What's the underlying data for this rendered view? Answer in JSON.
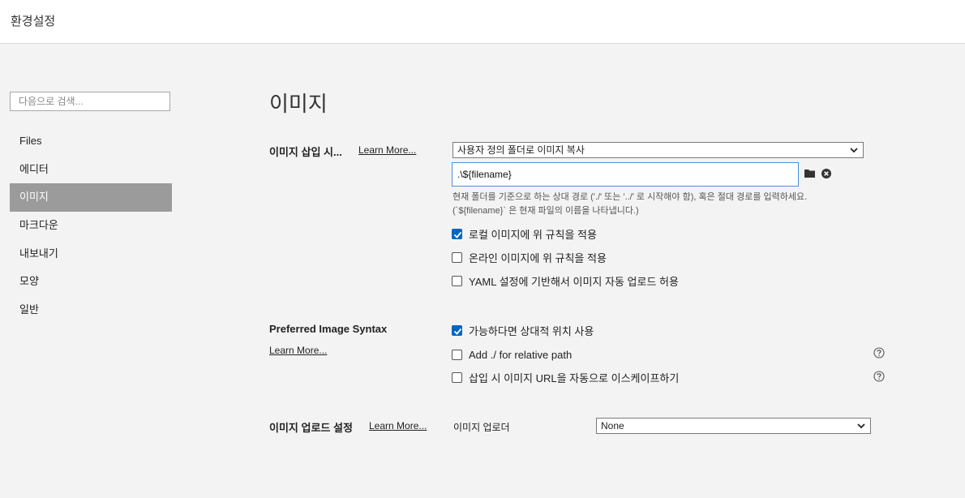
{
  "window": {
    "title": "환경설정"
  },
  "search": {
    "placeholder": "다음으로 검색..."
  },
  "sidebar": {
    "items": [
      {
        "label": "Files"
      },
      {
        "label": "에디터"
      },
      {
        "label": "이미지",
        "active": true
      },
      {
        "label": "마크다운"
      },
      {
        "label": "내보내기"
      },
      {
        "label": "모양"
      },
      {
        "label": "일반"
      }
    ]
  },
  "page": {
    "title": "이미지"
  },
  "insert_image": {
    "label": "이미지 삽입 시...",
    "learn_more": "Learn More...",
    "select_value": "사용자 정의 폴더로 이미지 복사",
    "path_value": ".\\${filename}",
    "folder_icon": "folder-icon",
    "clear_icon": "clear-icon",
    "hint_line1": "현재 폴더를 기준으로 하는 상대 경로 ('./' 또는 '../' 로 시작해야 함), 혹은 절대 경로를 입력하세요.",
    "hint_line2": "(`${filename}` 은 현재 파일의 이름을 나타냅니다.)",
    "options": [
      {
        "label": "로컬 이미지에 위 규칙을 적용",
        "checked": true
      },
      {
        "label": "온라인 이미지에 위 규칙을 적용",
        "checked": false
      },
      {
        "label": "YAML 설정에 기반해서 이미지 자동 업로드 허용",
        "checked": false
      }
    ]
  },
  "syntax": {
    "label": "Preferred Image Syntax",
    "learn_more": "Learn More...",
    "options": [
      {
        "label": "가능하다면 상대적 위치 사용",
        "checked": true
      },
      {
        "label": "Add ./ for relative path",
        "checked": false
      },
      {
        "label": "삽입 시 이미지 URL을 자동으로 이스케이프하기",
        "checked": false
      }
    ],
    "help_icon": "help-icon"
  },
  "upload": {
    "label": "이미지 업로드 설정",
    "learn_more": "Learn More...",
    "uploader_label": "이미지 업로더",
    "uploader_value": "None"
  },
  "colors": {
    "accent": "#0067c0",
    "active_nav": "#9b9b9b",
    "focus_border": "#4a90d9"
  }
}
